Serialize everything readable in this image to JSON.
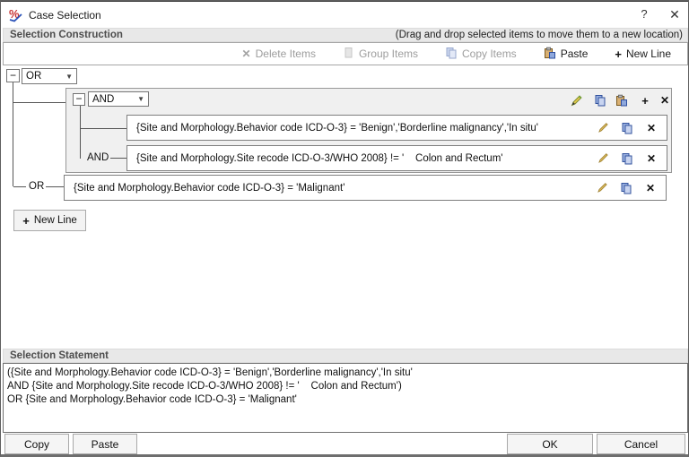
{
  "window": {
    "title": "Case Selection",
    "help": "?",
    "close": "✕"
  },
  "construction": {
    "header": "Selection Construction",
    "hint": "(Drag and drop selected items to move them to a new location)",
    "toolbar": [
      {
        "label": "Delete Items",
        "icon": "delete-x-icon",
        "enabled": false
      },
      {
        "label": "Group Items",
        "icon": "group-pages-icon",
        "enabled": false
      },
      {
        "label": "Copy Items",
        "icon": "copy-pages-icon",
        "enabled": false
      },
      {
        "label": "Paste",
        "icon": "paste-clipboard-icon",
        "enabled": true
      },
      {
        "label": "New Line",
        "icon": "plus-icon",
        "enabled": true
      }
    ],
    "tree": {
      "root_operator": "OR",
      "group_operator": "AND",
      "and_connector": "AND",
      "or_connector": "OR",
      "conditions": {
        "first": "{Site and Morphology.Behavior code ICD-O-3} = 'Benign','Borderline malignancy','In situ'",
        "second": "{Site and Morphology.Site recode ICD-O-3/WHO 2008} != '    Colon and Rectum'",
        "third": "{Site and Morphology.Behavior code ICD-O-3} = 'Malignant'"
      }
    },
    "new_line_button": "New Line"
  },
  "statement": {
    "header": "Selection Statement",
    "lines": [
      "({Site and Morphology.Behavior code ICD-O-3} = 'Benign','Borderline malignancy','In situ'",
      "AND {Site and Morphology.Site recode ICD-O-3/WHO 2008} != '    Colon and Rectum')",
      "OR {Site and Morphology.Behavior code ICD-O-3} = 'Malignant'"
    ]
  },
  "footer": {
    "copy": "Copy",
    "paste": "Paste",
    "ok": "OK",
    "cancel": "Cancel"
  }
}
